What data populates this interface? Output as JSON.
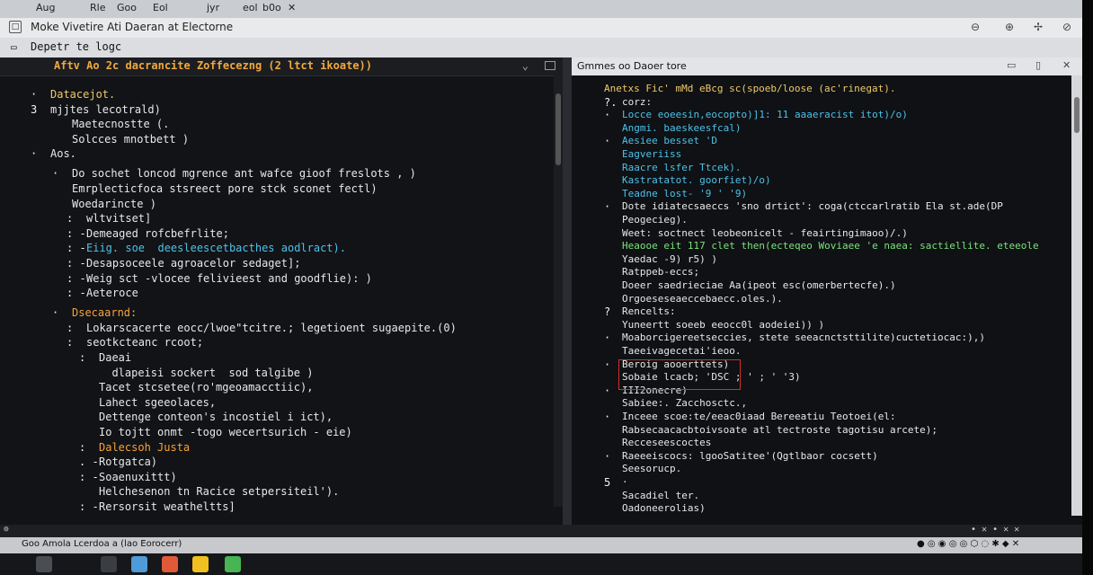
{
  "topstrip": {
    "items": [
      "Aug",
      "Rle",
      "Goo",
      "Eol",
      "jyr",
      "eol",
      "b0o",
      "✕"
    ]
  },
  "window": {
    "title": "Moke Vivetire Ati Daeran at Electorne"
  },
  "tab": {
    "title": "Depetr te logc"
  },
  "left_pane": {
    "header": "Aftv Ao 2c dacrancite Zoffecezng (2 ltct ikoate))",
    "lines": [
      {
        "bullet": "·",
        "text": "Datacejot.",
        "cls": "y",
        "indent": 1
      },
      {
        "bullet": "3",
        "text": "mjjtes lecotrald)",
        "cls": "w",
        "indent": 1
      },
      {
        "bullet": "",
        "text": "Maetecnostte (.",
        "cls": "w",
        "indent": 2
      },
      {
        "bullet": "",
        "text": "Solcces mnotbett )",
        "cls": "w",
        "indent": 2
      },
      {
        "bullet": "·",
        "text": "Aos.",
        "cls": "w",
        "indent": 1
      },
      {
        "bullet": "·",
        "text": "Do sochet loncod mgrence ant wafce gioof freslots , )",
        "cls": "w",
        "indent": 2
      },
      {
        "bullet": "",
        "text": "Emrplecticfoca stsreect pore stck sconet fectl)",
        "cls": "w",
        "indent": 2
      },
      {
        "bullet": "",
        "text": "Woedarincte )",
        "cls": "w",
        "indent": 2
      },
      {
        "bullet": ":",
        "text": "wltvitset]",
        "cls": "w",
        "indent": 3
      },
      {
        "bullet": ": -",
        "text": "Demeaged rofcbefrlite;",
        "cls": "w",
        "indent": 3
      },
      {
        "bullet": ": -",
        "text": "Eiig. soe  deesleescetbacthes aodlract).",
        "cls": "c",
        "indent": 3
      },
      {
        "bullet": ": -",
        "text": "Desapsoceele agroacelor sedaget];",
        "cls": "w",
        "indent": 3
      },
      {
        "bullet": ": -",
        "text": "Weig sct -vlocee felivieest and goodflie): )",
        "cls": "w",
        "indent": 3
      },
      {
        "bullet": ": -",
        "text": "Aeteroce",
        "cls": "w",
        "indent": 3
      },
      {
        "bullet": "·",
        "text": "Dsecaarnd:",
        "cls": "o",
        "indent": 2
      },
      {
        "bullet": ":",
        "text": "Lokarscacerte eocc/lwoe\"tcitre.; legetioent sugaepite.(0)",
        "cls": "w",
        "indent": 3
      },
      {
        "bullet": ":",
        "text": "seotkcteanc rcoot;",
        "cls": "w",
        "indent": 3
      },
      {
        "bullet": ":",
        "text": "Daeai",
        "cls": "w",
        "indent": 4
      },
      {
        "bullet": "",
        "text": "  dlapeisi sockert  sod talgibe )",
        "cls": "w",
        "indent": 4
      },
      {
        "bullet": "",
        "text": "Tacet stcsetee(ro'mgeoamacctiic),",
        "cls": "w",
        "indent": 4
      },
      {
        "bullet": "",
        "text": "Lahect sgeeolaces,",
        "cls": "w",
        "indent": 4
      },
      {
        "bullet": "",
        "text": "Dettenge conteon's incostiel i ict),",
        "cls": "w",
        "indent": 4
      },
      {
        "bullet": "",
        "text": "Io tojtt onmt -togo wecertsurich - eie)",
        "cls": "w",
        "indent": 4
      },
      {
        "bullet": ":",
        "text": "Dalecsoh Justa",
        "cls": "o",
        "indent": 4
      },
      {
        "bullet": ". -",
        "text": "Rotgatca)",
        "cls": "w",
        "indent": 4
      },
      {
        "bullet": ": -",
        "text": "Soaenuxittt)",
        "cls": "w",
        "indent": 4
      },
      {
        "bullet": "",
        "text": "Helchesenon tn Racice setpersiteil').",
        "cls": "w",
        "indent": 4
      },
      {
        "bullet": ": -",
        "text": "Rersorsit weatheltts]",
        "cls": "w",
        "indent": 4
      }
    ]
  },
  "right_pane": {
    "header": "Gmmes  oo Daoer tore",
    "lines": [
      {
        "bullet": "",
        "text": "Anetxs Fic' mMd eBcg sc(spoeb/loose (ac'rinegat).",
        "cls": "y"
      },
      {
        "bullet": "?.",
        "text": "corz:",
        "cls": "w"
      },
      {
        "bullet": "·",
        "text": "Locce eoeesin,eocopto)]1: 11 aaaeracist itot)/o)",
        "cls": "c"
      },
      {
        "bullet": "",
        "text": "Angmi. baeskeesfcal)",
        "cls": "c"
      },
      {
        "bullet": "·",
        "text": "Aesiee besset 'D",
        "cls": "c"
      },
      {
        "bullet": "",
        "text": "Eagveriiss",
        "cls": "c"
      },
      {
        "bullet": "",
        "text": "Raacre lsfer Ttcek).",
        "cls": "c"
      },
      {
        "bullet": "",
        "text": "Kastratatot. goorfiet)/o)",
        "cls": "c"
      },
      {
        "bullet": "",
        "text": "Teadne lost- '9 ' '9)",
        "cls": "c"
      },
      {
        "bullet": "·",
        "text": "Dote idiatecsaeccs 'sno drtict': coga(ctccarlratib Ela st.ade(DP",
        "cls": "w"
      },
      {
        "bullet": "",
        "text": "Peogecieg).",
        "cls": "w"
      },
      {
        "bullet": "",
        "text": "Weet: soctnect leobeonicelt - feairtingimaoo)/.)",
        "cls": "w"
      },
      {
        "bullet": "",
        "text": "Heaooe eit 117 clet then(ecteqeo Woviaee 'e naea: sactiellite. eteeole",
        "cls": "g"
      },
      {
        "bullet": "",
        "text": "Yaedac -9) r5) )",
        "cls": "w"
      },
      {
        "bullet": "",
        "text": "Ratppeb-eccs;",
        "cls": "w"
      },
      {
        "bullet": "",
        "text": "Doeer saedrieciae Aa(ipeot esc(omerbertecfe).)",
        "cls": "w"
      },
      {
        "bullet": "",
        "text": "Orgoeseseaeccebaecc.oles.).",
        "cls": "w"
      },
      {
        "bullet": "?",
        "text": "Rencelts:",
        "cls": "w"
      },
      {
        "bullet": "",
        "text": "Yuneertt soeeb eeocc0l aodeiei)) )",
        "cls": "w"
      },
      {
        "bullet": "·",
        "text": "Moaborcigereetseccies, stete seeacnctsttilite)cuctetiocac:),)",
        "cls": "w"
      },
      {
        "bullet": "",
        "text": "Taeeivagecetai'ieoo.",
        "cls": "w"
      },
      {
        "bullet": "·",
        "text": "Beroig aooerttets)",
        "cls": "w"
      },
      {
        "bullet": "",
        "text": "Sobaie lcacb; 'DSC ; ' ; ' '3)",
        "cls": "w"
      },
      {
        "bullet": "·",
        "text": "III2onecre)",
        "cls": "w"
      },
      {
        "bullet": "",
        "text": "Sabiee:. Zacchosctc.,",
        "cls": "w"
      },
      {
        "bullet": "·",
        "text": "Inceee scoe:te/eeac0iaad Bereeatiu Teotoei(el:",
        "cls": "w"
      },
      {
        "bullet": "",
        "text": "Rabsecaacacbtoivsoate atl tectroste tagotisu arcete);",
        "cls": "w"
      },
      {
        "bullet": "",
        "text": "Recceseescoctes",
        "cls": "w"
      },
      {
        "bullet": "·",
        "text": "Raeeeiscocs: lgooSatitee'(Qgtlbaor cocsett)",
        "cls": "w"
      },
      {
        "bullet": "",
        "text": "Seesorucp.",
        "cls": "w"
      },
      {
        "bullet": "5",
        "text": "·",
        "cls": "w"
      },
      {
        "bullet": "",
        "text": "Sacadiel ter.",
        "cls": "w"
      },
      {
        "bullet": "",
        "text": "Oadoneerolias)",
        "cls": "w"
      }
    ]
  },
  "bottom": {
    "left": "Goo  Amola Lcerdoa a (lao Eorocerr)"
  },
  "colors": {
    "accent": "#f2a93b",
    "cyan": "#4fc1e9",
    "highlight": "#d0302a"
  }
}
